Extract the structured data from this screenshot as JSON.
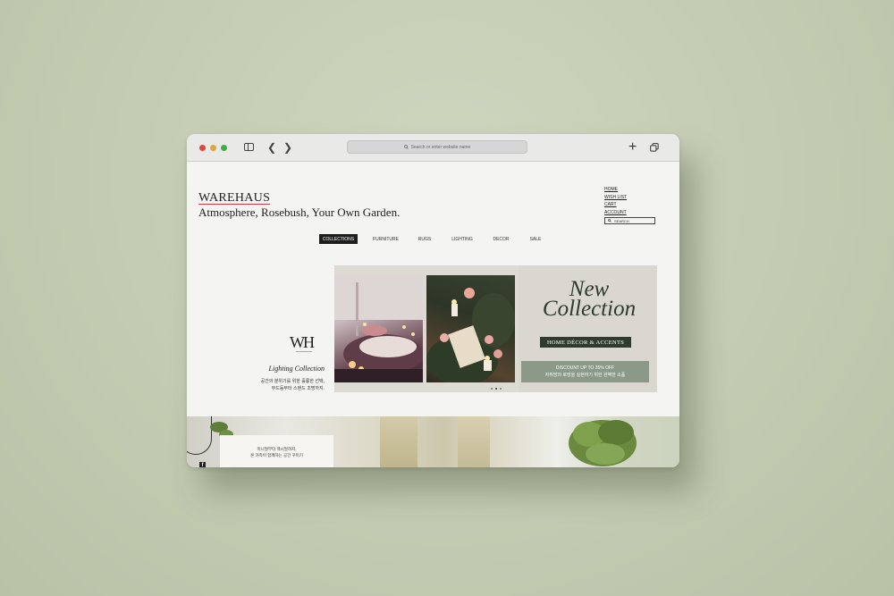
{
  "browser": {
    "address_placeholder": "Search or enter website name"
  },
  "site": {
    "logo": "WAREHAUS",
    "tagline": "Atmosphere, Rosebush, Your Own Garden.",
    "top_nav": [
      "HOME",
      "WISH LIST",
      "CART",
      "ACCOUNT"
    ],
    "search_label": "SEARCH",
    "categories": [
      "COLLECTIONS",
      "FURNITURE",
      "RUGS",
      "LIGHTING",
      "DECOR",
      "SALE"
    ],
    "active_category": "COLLECTIONS"
  },
  "feature": {
    "title": "Lighting Collection",
    "description_line1": "공간의 분위기를 위한 훌륭한 선택,",
    "description_line2": "무드등부터 스탠드 조명까지."
  },
  "hero": {
    "headline_line1": "New",
    "headline_line2": "Collection",
    "badge": "HOME DÉCOR & ACCENTS",
    "discount_line1": "DISCOUNT UP TO 35% OFF",
    "discount_line2": "자취방의 로망을 실현하기 위한 완벽한 소품"
  },
  "lower_banner": {
    "line1": "미니멀부터 맥시멀까지,",
    "line2": "온 가족이 함께하는 공간 꾸미기"
  },
  "colors": {
    "accent_dark": "#2f3b31",
    "accent_sage": "#8a9988",
    "logo_underline": "#c9394a"
  }
}
